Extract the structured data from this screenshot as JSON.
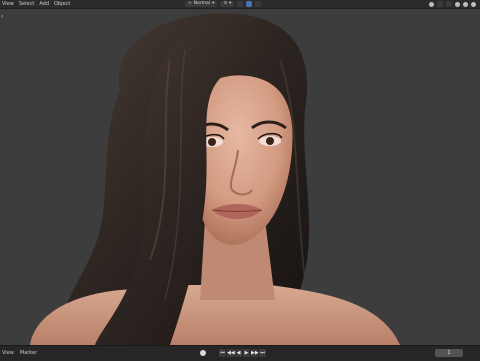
{
  "menu": {
    "items": [
      "View",
      "Select",
      "Add",
      "Object"
    ]
  },
  "header": {
    "orientation": "Normal",
    "transform_pivot": "⊙"
  },
  "viewport": {
    "background": "#3d3d3d",
    "hair_color": "#2a2421",
    "skin_color": "#d9a58e"
  },
  "timeline": {
    "menu_items": [
      "View",
      "Marker"
    ],
    "current_frame": "1",
    "transport": [
      "⏮",
      "◀◀",
      "◀",
      "▶",
      "▶▶",
      "⏭"
    ]
  }
}
